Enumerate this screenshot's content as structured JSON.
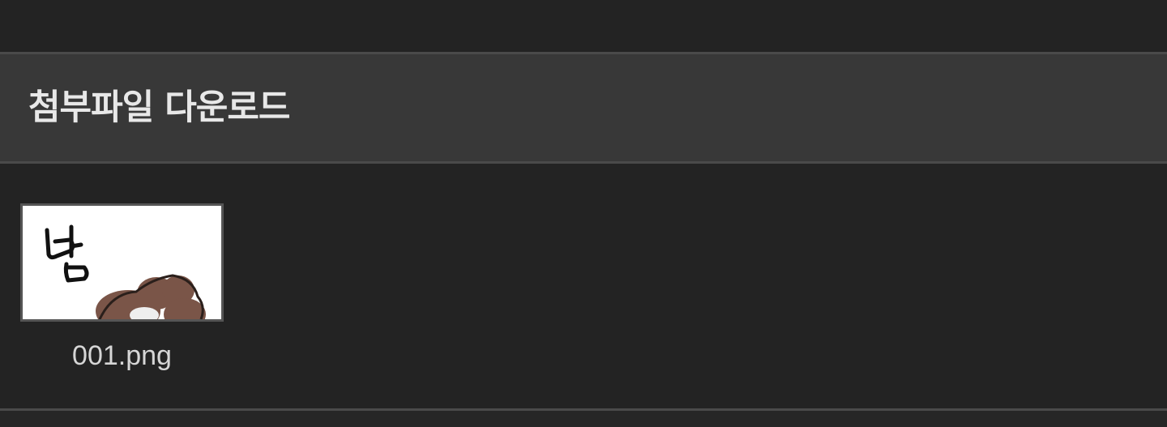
{
  "section": {
    "title": "첨부파일 다운로드"
  },
  "attachments": [
    {
      "file_name": "001.png",
      "thumbnail_icon": "image-thumbnail"
    }
  ],
  "colors": {
    "background": "#232323",
    "header_background": "#383838",
    "divider": "#4a4a4a",
    "title_text": "#e8e8e8",
    "file_name_text": "#d6d6d6"
  }
}
